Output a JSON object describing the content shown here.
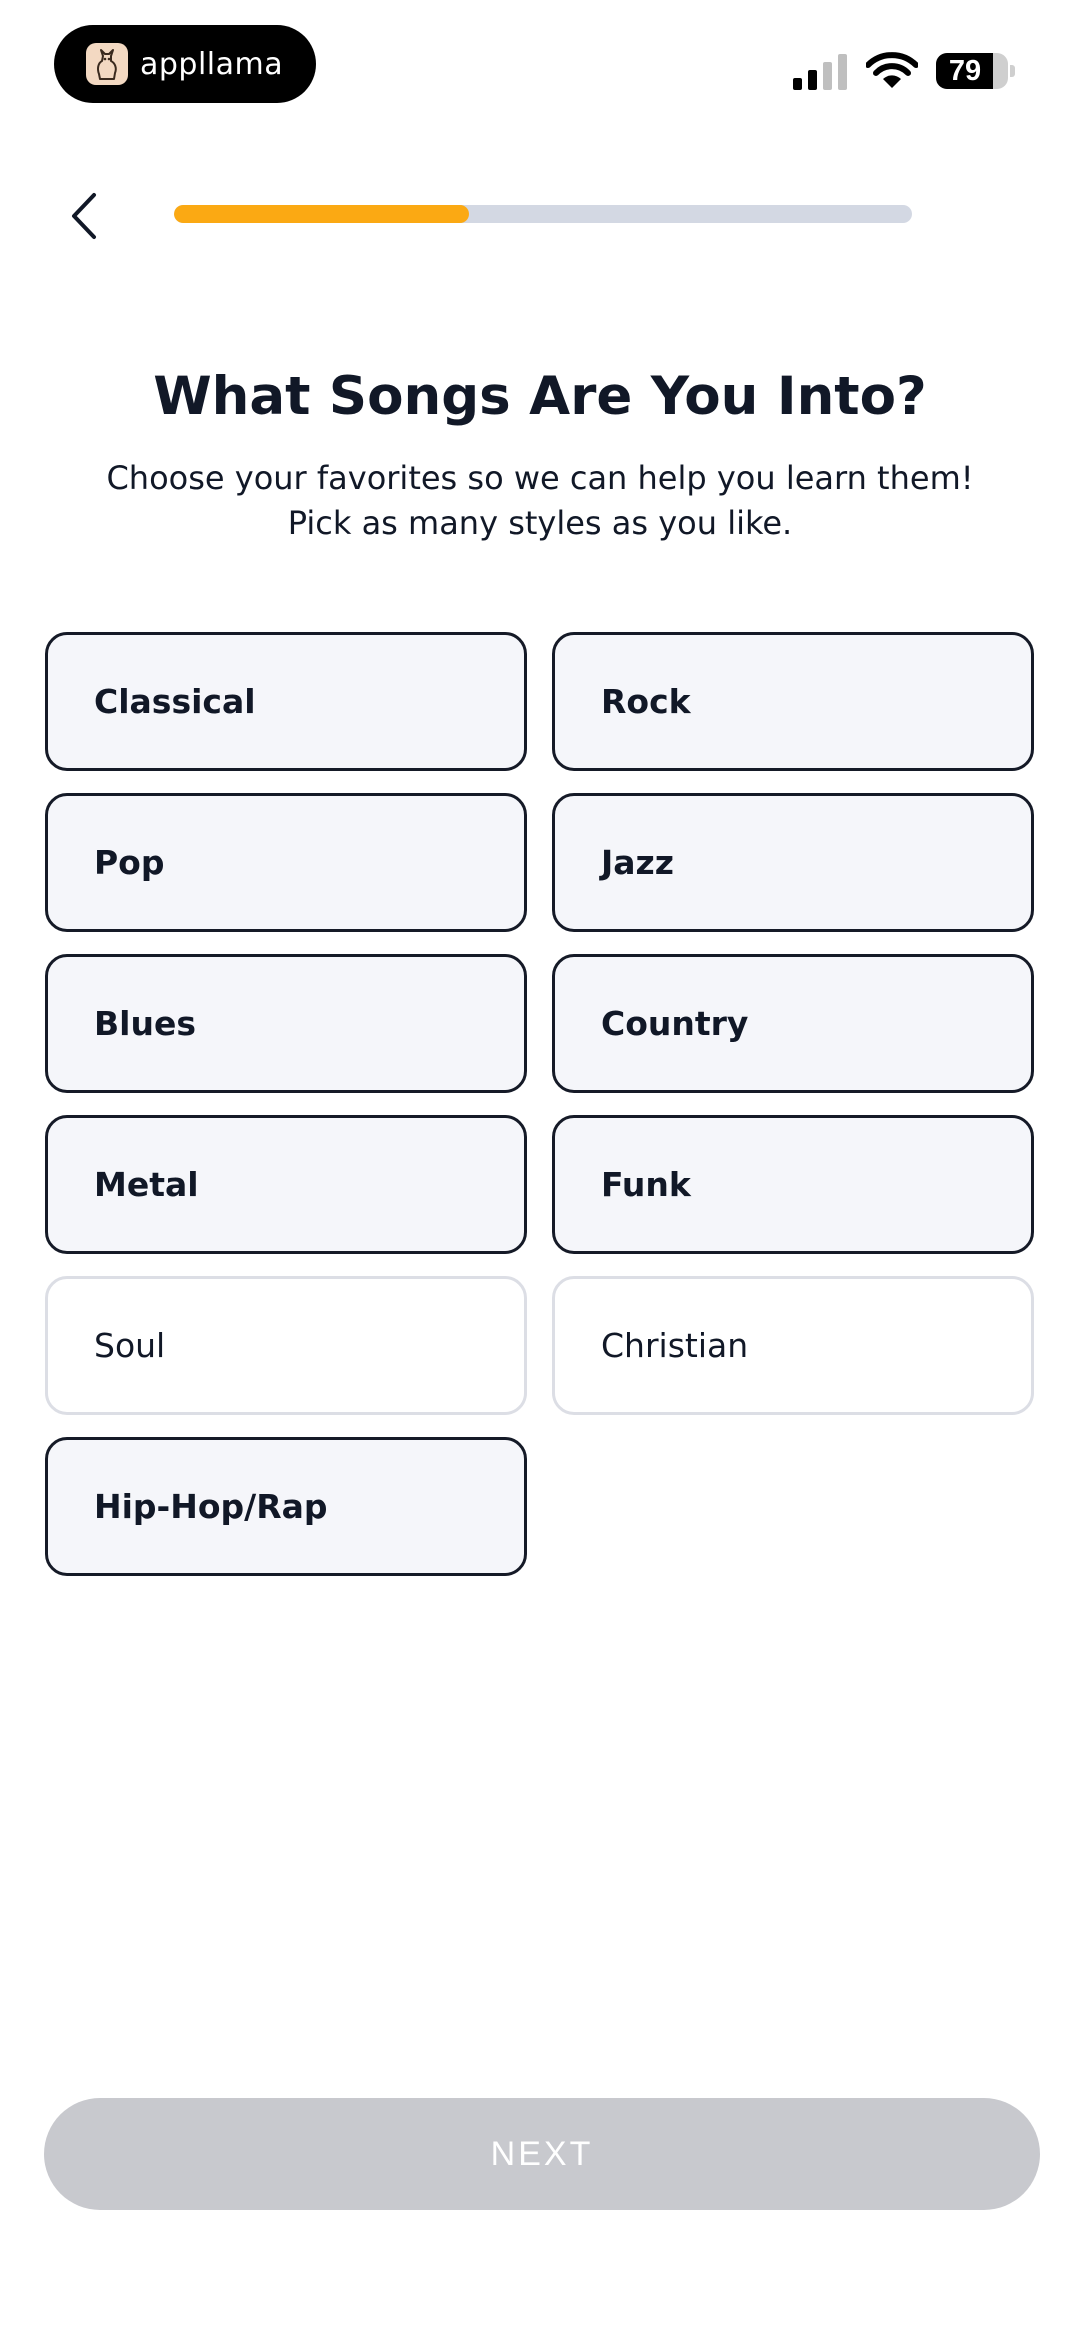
{
  "status_bar": {
    "app_name": "appllama",
    "battery_level": "79",
    "battery_fraction": 0.79,
    "signal_bars_active": 2,
    "signal_bars_total": 4
  },
  "header": {
    "back_icon": "chevron-left-icon",
    "progress_fraction": 0.4
  },
  "content": {
    "title": "What Songs Are You Into?",
    "subtitle": "Choose your favorites so we can help you learn them! Pick as many styles as you like."
  },
  "genres": [
    {
      "label": "Classical",
      "selected": true
    },
    {
      "label": "Rock",
      "selected": true
    },
    {
      "label": "Pop",
      "selected": true
    },
    {
      "label": "Jazz",
      "selected": true
    },
    {
      "label": "Blues",
      "selected": true
    },
    {
      "label": "Country",
      "selected": true
    },
    {
      "label": "Metal",
      "selected": true
    },
    {
      "label": "Funk",
      "selected": true
    },
    {
      "label": "Soul",
      "selected": false
    },
    {
      "label": "Christian",
      "selected": false
    },
    {
      "label": "Hip-Hop/Rap",
      "selected": true
    }
  ],
  "footer": {
    "next_label": "NEXT"
  },
  "colors": {
    "accent": "#fba913",
    "progress_track": "#d3d8e3",
    "selected_border": "#151a27",
    "selected_bg": "#f5f6fa",
    "unselected_border": "#dcdee5",
    "button_disabled": "#c8c9ce"
  }
}
